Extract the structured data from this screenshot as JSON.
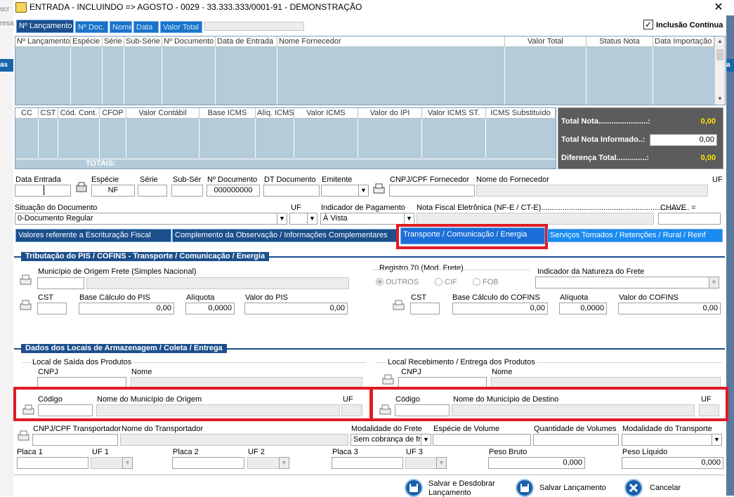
{
  "window": {
    "title": "ENTRADA  -  INCLUINDO   =>  AGOSTO  -  0029 - 33.333.333/0001-91 - DEMONSTRAÇÃO",
    "close": "✕"
  },
  "edge": {
    "left_top": "scr",
    "left_mid": "resa",
    "left_btn": "as",
    "right_btn": "a"
  },
  "inclusao": {
    "label": "Inclusão Contínua",
    "checked": "☑"
  },
  "search_tabs": [
    "Nº Lançamento",
    "Nº Doc.",
    "Nome",
    "Data",
    "Valor Total"
  ],
  "grid1": {
    "headers": [
      "Nº Lançamento",
      "Espécie",
      "Série",
      "Sub-Série",
      "Nº Documento",
      "Data de Entrada",
      "Nome Fornecedor",
      "Valor Total",
      "Status Nota",
      "Data Importação"
    ]
  },
  "grid2": {
    "headers": [
      "CC",
      "CST",
      "Cód. Cont.",
      "CFOP",
      "Valor Contábil",
      "Base ICMS",
      "Alíq. ICMS",
      "Valor ICMS",
      "Valor do IPI",
      "Valor ICMS ST.",
      "ICMS Substituído"
    ],
    "totais": "TOTAIS:"
  },
  "totals": {
    "total_nota_label": "Total Nota.......................:",
    "total_nota": "0,00",
    "informado_label": "Total Nota Informado..:",
    "informado": "0,00",
    "diferenca_label": "Diferença Total..............:",
    "diferenca": "0,00"
  },
  "form1": {
    "data_entrada": "Data Entrada",
    "especie": "Espécie",
    "especie_val": "NF",
    "serie": "Série",
    "subser": "Sub-Sér",
    "ndoc": "Nº Documento",
    "ndoc_val": "000000000",
    "dt_doc": "DT Documento",
    "emitente": "Emitente",
    "cnpj_forn": "CNPJ/CPF Fornecedor",
    "nome_forn": "Nome do Fornecedor",
    "uf": "UF"
  },
  "form2": {
    "situacao": "Situação do Documento",
    "situacao_val": "0-Documento Regular",
    "uf": "UF",
    "ind_pag": "Indicador de Pagamento",
    "ind_pag_val": "À Vista",
    "nfe": "Nota Fiscal Eletrônica (NF-E / CT-E)..................................................................... =",
    "chave": "CHAVE"
  },
  "subtabs": [
    "Valores referente a Escrituração Fiscal",
    "Complemento da Observação / Informações Complementares",
    "Transporte / Comunicação / Energia",
    "Serviços Tomados / Retenções / Rural / Reinf"
  ],
  "pis": {
    "section": "Tributação do PIS / COFINS - Transporte / Comunicação / Energia",
    "municipio": "Município de Origem Frete (Simples Nacional)",
    "registro": "Registro 70 (Mod. Frete)",
    "outros": "OUTROS",
    "cif": "CIF",
    "fob": "FOB",
    "natureza": "Indicador da Natureza do Frete",
    "cst": "CST",
    "base_pis": "Base Cálculo do PIS",
    "base_pis_val": "0,00",
    "aliq": "Alíquota",
    "aliq_pis_val": "0,0000",
    "valor_pis": "Valor do PIS",
    "valor_pis_val": "0,00",
    "cst2": "CST",
    "base_cofins": "Base Cálculo do COFINS",
    "base_cofins_val": "0,00",
    "aliq2": "Alíquota",
    "aliq_cofins_val": "0,0000",
    "valor_cofins": "Valor do COFINS",
    "valor_cofins_val": "0,00"
  },
  "locais": {
    "section": "Dados dos Locais de Armazenagem / Coleta / Entrega",
    "saida": "Local de Saída dos Produtos",
    "receb": "Local Recebimento / Entrega dos Produtos",
    "cnpj": "CNPJ",
    "nome": "Nome",
    "codigo": "Código",
    "mun_origem": "Nome do Município de Origem",
    "mun_destino": "Nome do Município de Destino",
    "uf": "UF"
  },
  "transp": {
    "cnpj": "CNPJ/CPF Transportador",
    "nome": "Nome do Transportador",
    "modalidade": "Modalidade do Frete",
    "modalidade_val": "Sem cobrança de fre",
    "especie": "Espécie de Volume",
    "qtd": "Quantidade de Volumes",
    "mod_transp": "Modalidade do Transporte",
    "placa1": "Placa 1",
    "uf1": "UF 1",
    "placa2": "Placa 2",
    "uf2": "UF 2",
    "placa3": "Placa 3",
    "uf3": "UF 3",
    "peso_bruto": "Peso Bruto",
    "peso_bruto_val": "0,000",
    "peso_liq": "Peso Líquido",
    "peso_liq_val": "0,000"
  },
  "buttons": {
    "salvar_desdobrar_1": "Salvar e Desdobrar",
    "salvar_desdobrar_2": "Lançamento",
    "salvar": "Salvar Lançamento",
    "cancelar": "Cancelar"
  }
}
